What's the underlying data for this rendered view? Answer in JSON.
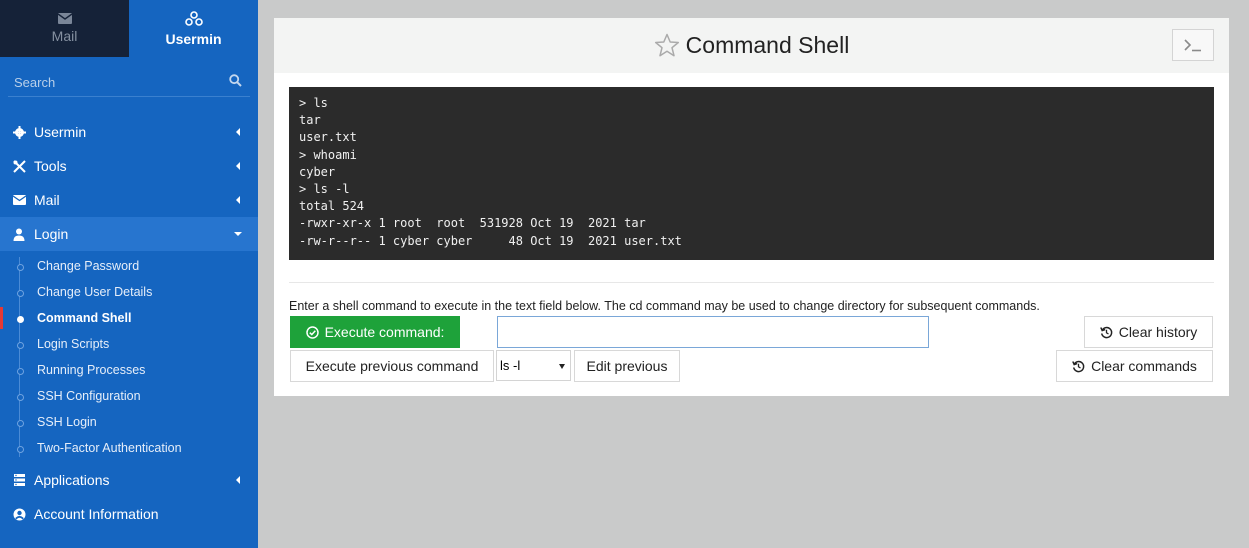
{
  "sidebar": {
    "switch": {
      "mail_label": "Mail",
      "usermin_label": "Usermin"
    },
    "search": {
      "placeholder": "Search"
    },
    "menu": [
      {
        "label": "Usermin",
        "icon": "gear-icon"
      },
      {
        "label": "Tools",
        "icon": "tools-icon"
      },
      {
        "label": "Mail",
        "icon": "envelope-icon"
      },
      {
        "label": "Login",
        "icon": "user-icon"
      },
      {
        "label": "Applications",
        "icon": "server-icon"
      },
      {
        "label": "Account Information",
        "icon": "account-icon"
      }
    ],
    "login_submenu": [
      "Change Password",
      "Change User Details",
      "Command Shell",
      "Login Scripts",
      "Running Processes",
      "SSH Configuration",
      "SSH Login",
      "Two-Factor Authentication"
    ]
  },
  "main": {
    "title": "Command Shell",
    "output_lines": [
      "> ls",
      "tar",
      "user.txt",
      "> whoami",
      "cyber",
      "> ls -l",
      "total 524",
      "-rwxr-xr-x 1 root  root  531928 Oct 19  2021 tar",
      "-rw-r--r-- 1 cyber cyber     48 Oct 19  2021 user.txt"
    ],
    "help_text": "Enter a shell command to execute in the text field below. The cd command may be used to change directory for subsequent commands.",
    "execute_label": "Execute command:",
    "command_value": "",
    "execute_previous_label": "Execute previous command",
    "previous_selected": "ls -l",
    "edit_previous_label": "Edit previous",
    "clear_history_label": "Clear history",
    "clear_commands_label": "Clear commands"
  },
  "colors": {
    "sidebar": "#1565c0",
    "execute": "#1ea23a",
    "terminal": "#2b2b2b"
  }
}
